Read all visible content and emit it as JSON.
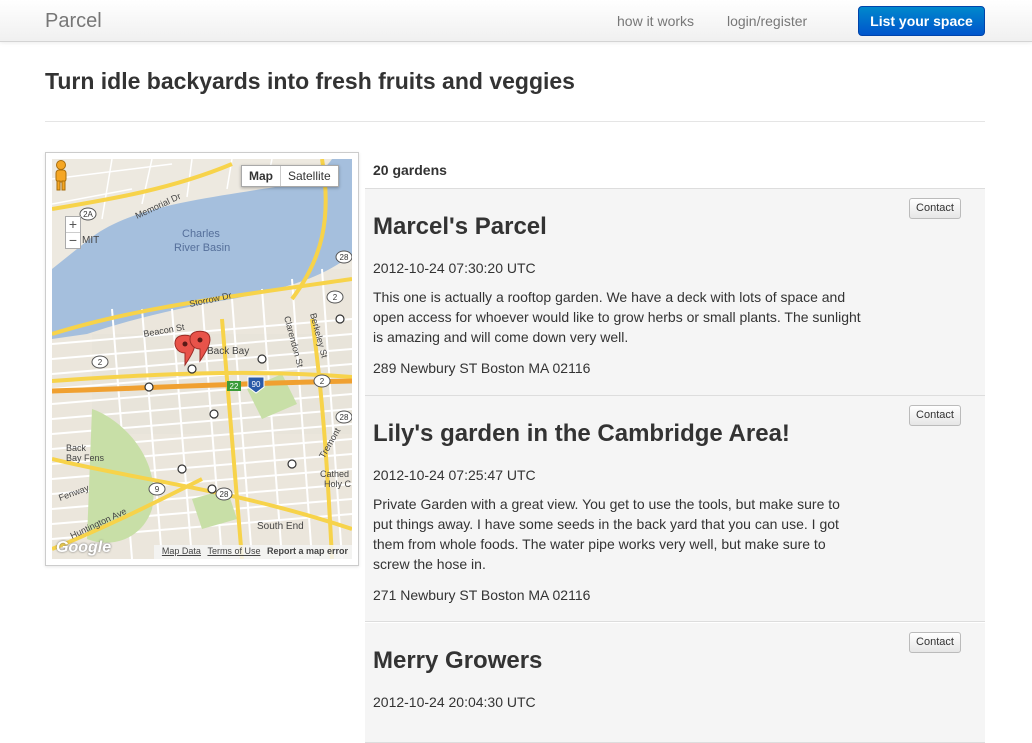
{
  "navbar": {
    "brand": "Parcel",
    "links": [
      "how it works",
      "login/register"
    ],
    "cta": "List your space",
    "cta_color": "#0074cc"
  },
  "page": {
    "title": "Turn idle backyards into fresh fruits and veggies"
  },
  "map": {
    "type_buttons": [
      "Map",
      "Satellite"
    ],
    "active_type": "Map",
    "zoom_controls": [
      "+",
      "−"
    ],
    "labels": [
      "Charles River Basin",
      "Memorial Dr",
      "Storrow Dr",
      "Beacon St",
      "Back Bay",
      "Clarendon St",
      "Berkeley St",
      "MIT",
      "Fenway",
      "Huntington Ave",
      "South End",
      "Back Bay Fens",
      "Tremont",
      "Cathedral Holy Cross"
    ],
    "road_badges": [
      "2A",
      "28",
      "2",
      "2",
      "2",
      "9",
      "28",
      "22",
      "90",
      "28"
    ],
    "logo": "Google",
    "footer_links": [
      "Map Data",
      "Terms of Use"
    ],
    "report": "Report a map error",
    "markers": 2
  },
  "listing": {
    "count": "20 gardens",
    "contact_label": "Contact",
    "gardens": [
      {
        "name": "Marcel's Parcel",
        "timestamp": "2012-10-24 07:30:20 UTC",
        "description": "This one is actually a rooftop garden. We have a deck with lots of space and open access for whoever would like to grow herbs or small plants. The sunlight is amazing and will come down very well.",
        "address": "289 Newbury ST Boston MA 02116"
      },
      {
        "name": "Lily's garden in the Cambridge Area!",
        "timestamp": "2012-10-24 07:25:47 UTC",
        "description": "Private Garden with a great view. You get to use the tools, but make sure to put things away. I have some seeds in the back yard that you can use. I got them from whole foods. The water pipe works very well, but make sure to screw the hose in.",
        "address": "271 Newbury ST Boston MA 02116"
      },
      {
        "name": "Merry Growers",
        "timestamp": "2012-10-24 20:04:30 UTC"
      }
    ]
  }
}
